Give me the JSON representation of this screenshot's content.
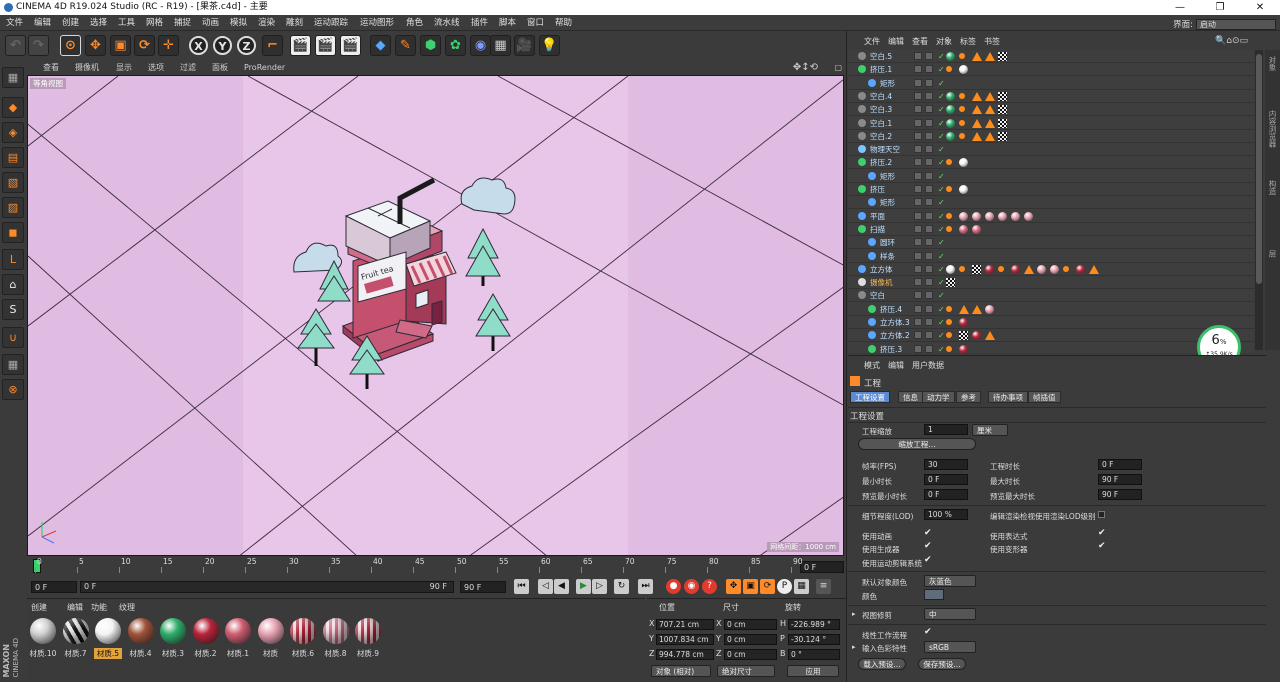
{
  "title": "CINEMA 4D R19.024 Studio (RC - R19) - [果茶.c4d] - 主要",
  "menu": [
    "文件",
    "编辑",
    "创建",
    "选择",
    "工具",
    "网格",
    "捕捉",
    "动画",
    "模拟",
    "渲染",
    "雕刻",
    "运动跟踪",
    "运动图形",
    "角色",
    "流水线",
    "插件",
    "脚本",
    "窗口",
    "帮助"
  ],
  "layout": {
    "label": "界面:",
    "value": "启动"
  },
  "viewport_menu": [
    "查看",
    "摄像机",
    "显示",
    "选项",
    "过滤",
    "面板",
    "ProRender"
  ],
  "viewport_label": "等角视图",
  "viewport_scale": "网格间距：1000 cm",
  "scene": {
    "sign_text": "Fruit tea"
  },
  "timeline": {
    "ticks": [
      "0",
      "5",
      "10",
      "15",
      "20",
      "25",
      "30",
      "35",
      "40",
      "45",
      "50",
      "55",
      "60",
      "65",
      "70",
      "75",
      "80",
      "85",
      "90"
    ],
    "end": "0 F"
  },
  "playbar": {
    "start": "0 F",
    "range_start": "0 F",
    "range_end": "90 F",
    "end": "90 F"
  },
  "material_menu": [
    "创建",
    "编辑",
    "功能",
    "纹理"
  ],
  "materials": [
    {
      "name": "材质.10",
      "color": "#d0d0d0"
    },
    {
      "name": "材质.7",
      "color": "stripe-bw"
    },
    {
      "name": "材质.5",
      "color": "#f4f4f4",
      "selected": true
    },
    {
      "name": "材质.4",
      "color": "#a0533a"
    },
    {
      "name": "材质.3",
      "color": "#2fae6a"
    },
    {
      "name": "材质.2",
      "color": "#b8243a"
    },
    {
      "name": "材质.1",
      "color": "#cf5d72"
    },
    {
      "name": "材质",
      "color": "#e7a3b2"
    },
    {
      "name": "材质.6",
      "color": "stripe-pink"
    },
    {
      "name": "材质.8",
      "color": "stripe-pink2"
    },
    {
      "name": "材质.9",
      "color": "stripe-red"
    }
  ],
  "coords": {
    "headers": [
      "位置",
      "尺寸",
      "旋转"
    ],
    "rows": [
      {
        "axis": "X",
        "pos": "707.21 cm",
        "size": "0 cm",
        "raxis": "H",
        "rot": "-226.989 °"
      },
      {
        "axis": "Y",
        "pos": "1007.834 cm",
        "size": "0 cm",
        "raxis": "P",
        "rot": "-30.124 °"
      },
      {
        "axis": "Z",
        "pos": "994.778 cm",
        "size": "0 cm",
        "raxis": "B",
        "rot": "0 °"
      }
    ],
    "mode": "对象 (相对)",
    "size_mode": "绝对尺寸",
    "apply": "应用"
  },
  "object_menu": [
    "文件",
    "编辑",
    "查看",
    "对象",
    "标签",
    "书签"
  ],
  "objects": [
    {
      "name": "空白.5",
      "indent": 0
    },
    {
      "name": "挤压.1",
      "indent": 0
    },
    {
      "name": "矩形",
      "indent": 1
    },
    {
      "name": "空白.4",
      "indent": 0
    },
    {
      "name": "空白.3",
      "indent": 0
    },
    {
      "name": "空白.1",
      "indent": 0
    },
    {
      "name": "空白.2",
      "indent": 0
    },
    {
      "name": "物理天空",
      "indent": 0
    },
    {
      "name": "挤压.2",
      "indent": 0
    },
    {
      "name": "矩形",
      "indent": 1
    },
    {
      "name": "挤压",
      "indent": 0
    },
    {
      "name": "矩形",
      "indent": 1
    },
    {
      "name": "平面",
      "indent": 0
    },
    {
      "name": "扫描",
      "indent": 0
    },
    {
      "name": "圆环",
      "indent": 1
    },
    {
      "name": "样条",
      "indent": 1
    },
    {
      "name": "立方体",
      "indent": 0
    },
    {
      "name": "摄像机",
      "indent": 0,
      "highlight": true
    },
    {
      "name": "空白",
      "indent": 0
    },
    {
      "name": "挤压.4",
      "indent": 1
    },
    {
      "name": "立方体.3",
      "indent": 1
    },
    {
      "name": "立方体.2",
      "indent": 1
    },
    {
      "name": "挤压.3",
      "indent": 1
    }
  ],
  "sidetabs": [
    "对象",
    "内容浏览器",
    "构造",
    "层"
  ],
  "badge": {
    "percent": "6",
    "unit": "%",
    "speed": "↑35.9K/s"
  },
  "attr": {
    "menu": [
      "模式",
      "编辑",
      "用户数据"
    ],
    "title": "工程",
    "tabs": [
      "工程设置",
      "信息",
      "动力学",
      "参考",
      "待办事项",
      "帧插值"
    ],
    "section": "工程设置",
    "scale_label": "工程缩放",
    "scale_value": "1",
    "scale_unit": "厘米",
    "scale_btn": "缩放工程...",
    "fps_label": "帧率(FPS)",
    "fps": "30",
    "time_label": "工程时长",
    "time": "0 F",
    "min_label": "最小时长",
    "min": "0 F",
    "max_label": "最大时长",
    "max": "90 F",
    "pmin_label": "预览最小时长",
    "pmin": "0 F",
    "pmax_label": "预览最大时长",
    "pmax": "90 F",
    "lod_label": "细节程度(LOD)",
    "lod": "100 %",
    "lod2_label": "编辑渲染检视使用渲染LOD级别",
    "anim_label": "使用动画",
    "expr_label": "使用表达式",
    "gen_label": "使用生成器",
    "def_label": "使用变形器",
    "motion_label": "使用运动剪辑系统",
    "color_label": "默认对象颜色",
    "color_value": "灰蓝色",
    "colorswatch_label": "颜色",
    "clip_label": "视图修剪",
    "clip_value": "中",
    "linear_label": "线性工作流程",
    "profile_label": "输入色彩特性",
    "profile_value": "sRGB",
    "load_btn": "载入预设...",
    "save_btn": "保存预设..."
  }
}
